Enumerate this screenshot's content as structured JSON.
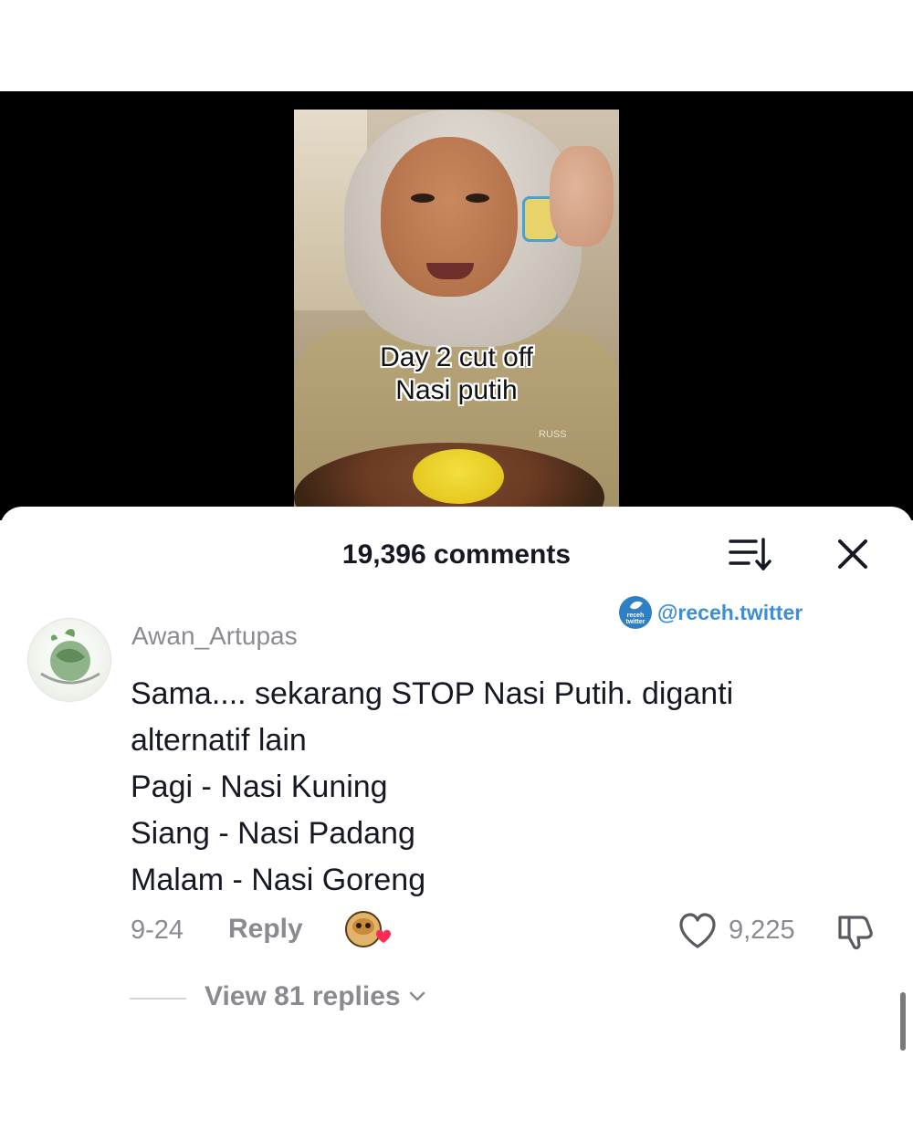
{
  "video": {
    "caption_line1": "Day 2 cut off",
    "caption_line2": "Nasi putih",
    "shirt_brand": "RUSS"
  },
  "comments_panel": {
    "count_label": "19,396 comments",
    "sort_icon": "sort-icon",
    "close_icon": "close-icon"
  },
  "watermark": {
    "badge_text": "receh twitter",
    "handle": "@receh.twitter",
    "color": "#3c8fd6"
  },
  "comment": {
    "username": "Awan_Artupas",
    "lines": [
      "Sama.... sekarang STOP Nasi Putih. diganti",
      "alternatif lain",
      "Pagi - Nasi Kuning",
      "Siang - Nasi Padang",
      "Malam - Nasi Goreng"
    ],
    "date": "9-24",
    "reply_label": "Reply",
    "like_count": "9,225",
    "view_replies_label": "View 81 replies"
  },
  "colors": {
    "primary_text": "#161823",
    "secondary_text": "#8a8b91",
    "heart_pink": "#fe2c55"
  }
}
